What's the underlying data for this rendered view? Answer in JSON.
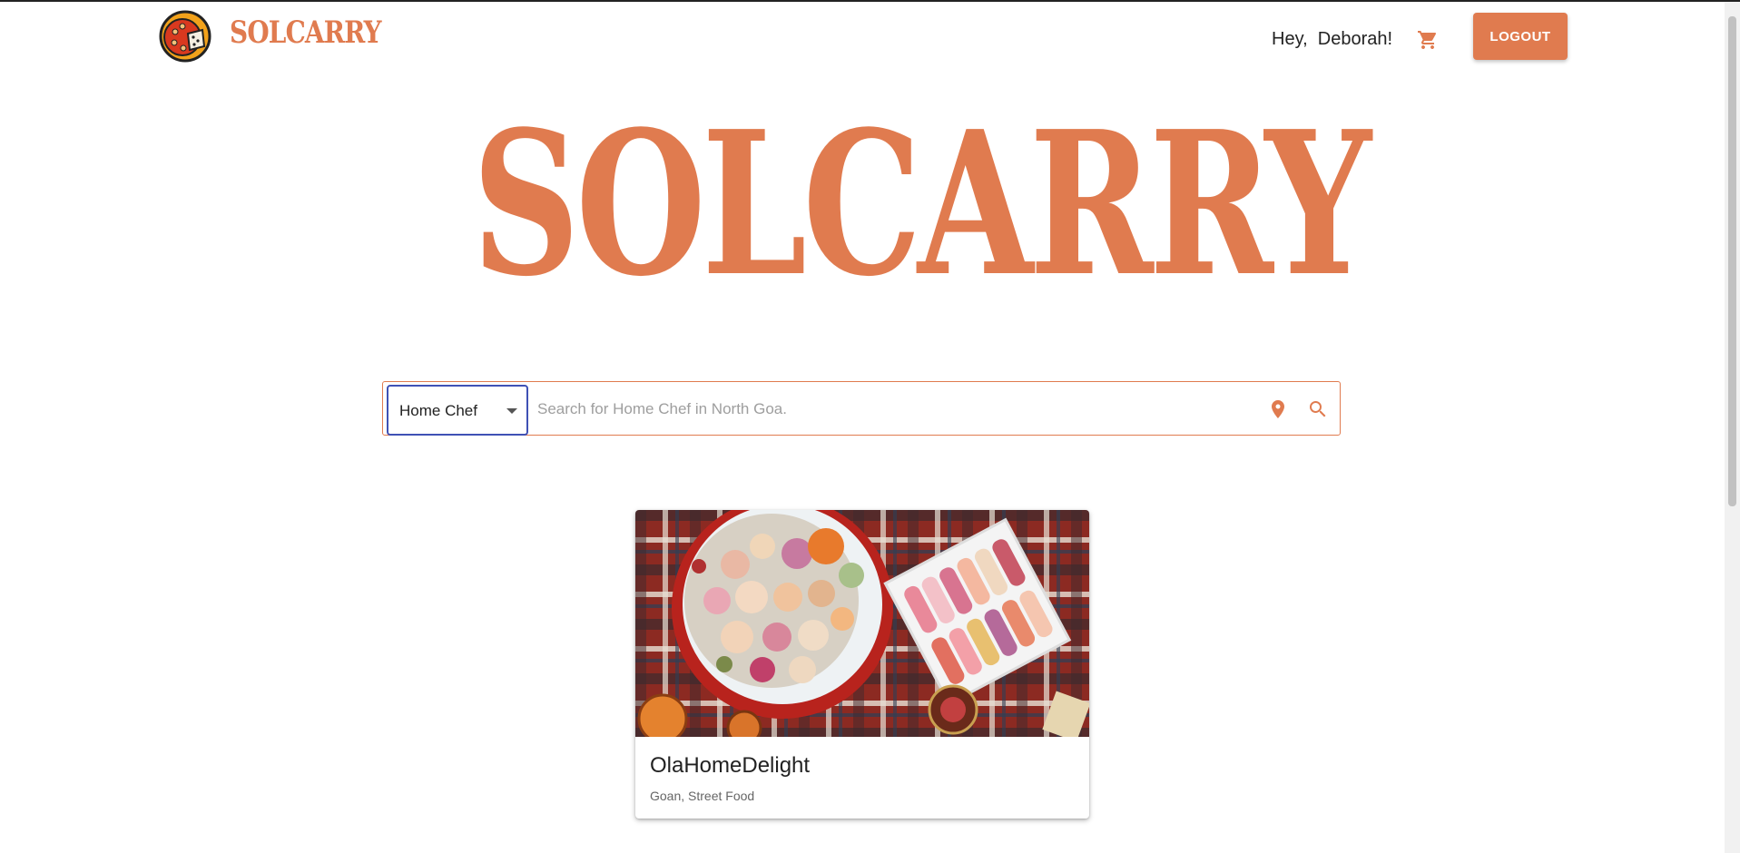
{
  "header": {
    "brand": "SOLCARRY",
    "greeting": "Hey,  Deborah!",
    "logout_label": "LOGOUT"
  },
  "hero": {
    "title": "SOLCARRY"
  },
  "search": {
    "category": "Home Chef",
    "placeholder": "Search for Home Chef in North Goa.",
    "value": ""
  },
  "results": [
    {
      "name": "OlaHomeDelight",
      "cuisines": "Goan, Street Food"
    }
  ],
  "colors": {
    "brand": "#e07b4f",
    "select_focus": "#3f51b5"
  },
  "icons": {
    "cart": "cart-icon",
    "location": "location-pin-icon",
    "search": "search-icon"
  }
}
